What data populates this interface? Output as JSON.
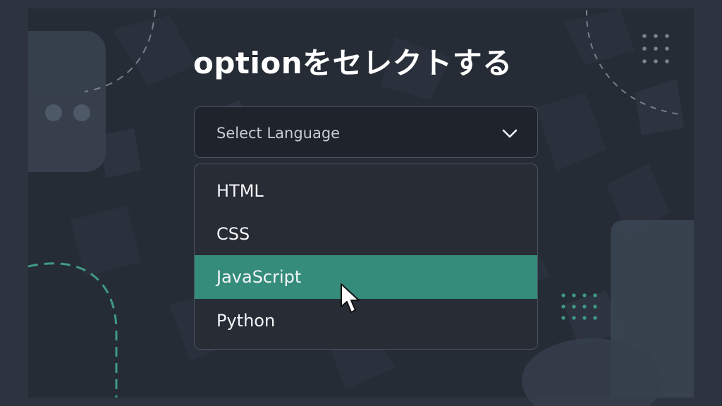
{
  "title": "optionをセレクトする",
  "select": {
    "placeholder": "Select Language",
    "icon": "chevron-down-icon"
  },
  "options": [
    {
      "label": "HTML",
      "selected": false
    },
    {
      "label": "CSS",
      "selected": false
    },
    {
      "label": "JavaScript",
      "selected": true
    },
    {
      "label": "Python",
      "selected": false
    }
  ],
  "colors": {
    "background": "#2d343f",
    "panel": "#262c36",
    "select_bg": "#1f242c",
    "dropdown_bg": "#272c35",
    "highlight": "#358c7b",
    "text": "#f4f5f7",
    "placeholder": "#c8ccd3",
    "border": "#4a5260"
  },
  "pointer": {
    "icon": "mouse-pointer-icon"
  }
}
